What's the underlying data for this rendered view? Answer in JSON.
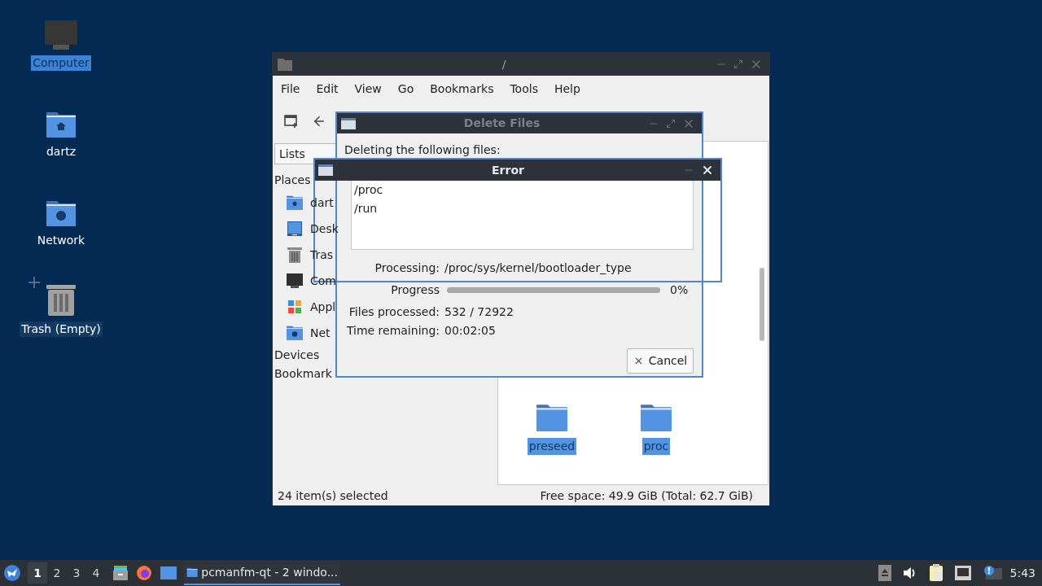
{
  "desktop_icons": [
    {
      "label": "Computer",
      "kind": "computer",
      "selected": true
    },
    {
      "label": "dartz",
      "kind": "home",
      "selected": false
    },
    {
      "label": "Network",
      "kind": "network",
      "selected": false
    },
    {
      "label": "Trash (Empty)",
      "kind": "trash",
      "selected": false,
      "hovered": true
    }
  ],
  "file_manager": {
    "title": "/",
    "menu": [
      "File",
      "Edit",
      "View",
      "Go",
      "Bookmarks",
      "Tools",
      "Help"
    ],
    "side_panel": {
      "mode": "Lists",
      "sections": [
        {
          "label": "Places",
          "items": [
            {
              "label": "dart",
              "kind": "home"
            },
            {
              "label": "Desk",
              "kind": "desktop"
            },
            {
              "label": "Tras",
              "kind": "trash"
            },
            {
              "label": "Com",
              "kind": "computer"
            },
            {
              "label": "Appl",
              "kind": "apps"
            },
            {
              "label": "Net",
              "kind": "network"
            }
          ]
        },
        {
          "label": "Devices"
        },
        {
          "label": "Bookmark"
        }
      ]
    },
    "files": [
      {
        "name": "preseed",
        "selected": true
      },
      {
        "name": "proc",
        "selected": true
      }
    ],
    "status_bar": {
      "left": "24 item(s) selected",
      "right": "Free space: 49.9 GiB (Total: 62.7 GiB)"
    }
  },
  "delete_dialog": {
    "title": "Delete Files",
    "active": false,
    "heading": "Deleting the following files:",
    "files": [
      "/proc",
      "/run"
    ],
    "processing": {
      "label": "Processing:",
      "value": "/proc/sys/kernel/bootloader_type"
    },
    "progress": {
      "label": "Progress",
      "level": 0,
      "reading": "0%"
    },
    "files_processed": {
      "label": "Files processed:",
      "value": "532 / 72922"
    },
    "time_remaining": {
      "label": "Time remaining:",
      "value": "00:02:05"
    },
    "cancel": "Cancel"
  },
  "error_dialog": {
    "title": "Error",
    "active": true
  },
  "taskbar": {
    "workspaces": [
      {
        "label": "1",
        "selected": true
      },
      {
        "label": "2",
        "selected": false
      },
      {
        "label": "3",
        "selected": false
      },
      {
        "label": "4",
        "selected": false
      }
    ],
    "launchers": [
      {
        "kind": "files"
      },
      {
        "kind": "browser"
      },
      {
        "kind": "desktop"
      }
    ],
    "tasks": [
      {
        "label": "pcmanfm-qt - 2 windo...",
        "active": true
      }
    ],
    "tray": [
      {
        "kind": "eject"
      },
      {
        "kind": "volume"
      },
      {
        "kind": "clipboard"
      },
      {
        "kind": "network"
      },
      {
        "kind": "notification"
      }
    ],
    "clock": "5:43"
  }
}
